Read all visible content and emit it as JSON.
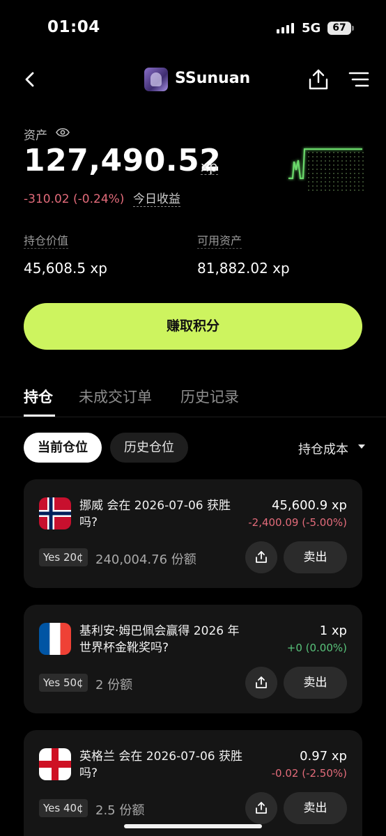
{
  "status_bar": {
    "time": "01:04",
    "network": "5G",
    "battery": "67"
  },
  "header": {
    "username": "SSunuan"
  },
  "assets": {
    "label": "资产",
    "balance": "127,490.52",
    "unit": "xp",
    "change": "-310.02 (-0.24%)",
    "change_label": "今日收益"
  },
  "stats": {
    "holdings_label": "持仓价值",
    "holdings_value": "45,608.5 xp",
    "available_label": "可用资产",
    "available_value": "81,882.02 xp"
  },
  "cta_label": "赚取积分",
  "tabs": [
    {
      "label": "持仓"
    },
    {
      "label": "未成交订单"
    },
    {
      "label": "历史记录"
    }
  ],
  "filters": {
    "current": "当前仓位",
    "history": "历史仓位",
    "sort": "持仓成本"
  },
  "positions": [
    {
      "flag": "norway",
      "title": "挪威 会在 2026-07-06 获胜吗?",
      "value": "45,600.9 xp",
      "pnl": "-2,400.09 (-5.00%)",
      "pnl_color": "#e26b7a",
      "tag": "Yes 20¢",
      "shares": "240,004.76 份额",
      "sell": "卖出"
    },
    {
      "flag": "france",
      "title": "基利安·姆巴佩会赢得 2026 年世界杯金靴奖吗?",
      "value": "1 xp",
      "pnl": "+0 (0.00%)",
      "pnl_color": "#58c27a",
      "tag": "Yes 50¢",
      "shares": "2 份额",
      "sell": "卖出"
    },
    {
      "flag": "england",
      "title": "英格兰 会在 2026-07-06 获胜吗?",
      "value": "0.97 xp",
      "pnl": "-0.02 (-2.50%)",
      "pnl_color": "#e26b7a",
      "tag": "Yes 40¢",
      "shares": "2.5 份额",
      "sell": "卖出"
    }
  ],
  "colors": {
    "accent": "#cdf45f",
    "negative": "#e26b7a",
    "positive": "#58c27a"
  }
}
